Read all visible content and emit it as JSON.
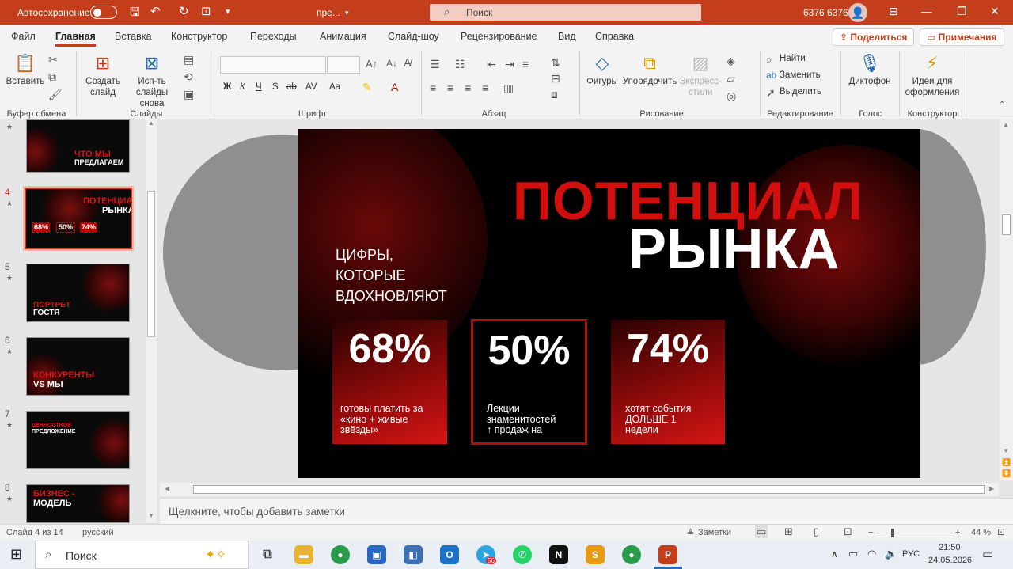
{
  "titlebar": {
    "autosave_label": "Автосохранение",
    "doc_name": "пре...",
    "search_placeholder": "Поиск",
    "user_name": "6376 6376"
  },
  "menu": {
    "tabs": [
      "Файл",
      "Главная",
      "Вставка",
      "Конструктор",
      "Переходы",
      "Анимация",
      "Слайд-шоу",
      "Рецензирование",
      "Вид",
      "Справка"
    ],
    "active_tab": "Главная",
    "share_label": "Поделиться",
    "comments_label": "Примечания"
  },
  "ribbon": {
    "paste": "Вставить",
    "new_slide": [
      "Создать",
      "слайд"
    ],
    "reuse": [
      "Исп-ть",
      "слайды снова"
    ],
    "shapes": "Фигуры",
    "arrange": "Упорядочить",
    "quick_styles": [
      "Экспресс-",
      "стили"
    ],
    "find": "Найти",
    "replace": "Заменить",
    "select": "Выделить",
    "dictate": "Диктофон",
    "designer": [
      "Идеи для",
      "оформления"
    ],
    "bold": "Ж",
    "italic": "К",
    "underline": "Ч",
    "strike": "S",
    "font_size_label": "Аa",
    "groups": [
      "Буфер обмена",
      "Слайды",
      "Шрифт",
      "Абзац",
      "Рисование",
      "Редактирование",
      "Голос",
      "Конструктор"
    ]
  },
  "thumbnails": [
    {
      "num": "",
      "line1": "ЧТО МЫ",
      "line2": "ПРЕДЛАГАЕМ"
    },
    {
      "num": "4",
      "line1": "ПОТЕНЦИАЛ",
      "line2": "РЫНКА",
      "stats": [
        "68%",
        "50%",
        "74%"
      ]
    },
    {
      "num": "5",
      "line1": "ПОРТРЕТ",
      "line2": "ГОСТЯ"
    },
    {
      "num": "6",
      "line1": "КОНКУРЕНТЫ",
      "line2": "VS МЫ"
    },
    {
      "num": "7",
      "line1": "ЦЕННОСТНОЕ",
      "line2": "ПРЕДЛОЖЕНИЕ"
    },
    {
      "num": "8",
      "line1": "БИЗНЕС -",
      "line2": "МОДЕЛЬ"
    }
  ],
  "slide": {
    "title_red": "ПОТЕНЦИАЛ",
    "title_white": "РЫНКА",
    "subtitle": [
      "ЦИФРЫ,",
      "КОТОРЫЕ",
      "ВДОХНОВЛЯЮТ"
    ],
    "cards": [
      {
        "value": "68%",
        "caption": [
          "готовы платить за",
          "«кино + живые",
          "звёзды»"
        ]
      },
      {
        "value": "50%",
        "caption": [
          "Лекции",
          "знаменитостей",
          "↑ продаж на"
        ]
      },
      {
        "value": "74%",
        "caption": [
          "хотят события",
          "ДОЛЬШЕ 1",
          "недели"
        ]
      }
    ],
    "colors": {
      "accent": "#d10f0f",
      "background": "#000000"
    }
  },
  "notes_placeholder": "Щелкните, чтобы добавить заметки",
  "status": {
    "slide_counter": "Слайд 4 из 14",
    "language": "русский",
    "notes_btn": "Заметки",
    "zoom": "44 %"
  },
  "taskbar": {
    "search": "Поиск",
    "time": "21:50",
    "date": "24.05.2026",
    "lang": "РУС",
    "telegram_badge": "56"
  }
}
